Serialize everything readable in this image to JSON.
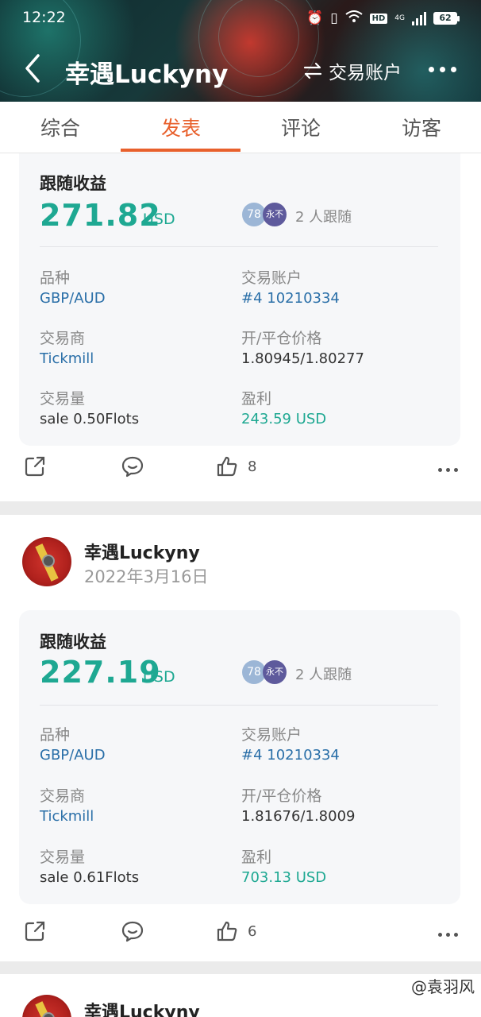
{
  "status_bar": {
    "time": "12:22",
    "network": "4G",
    "hd": "HD",
    "battery": "62"
  },
  "nav": {
    "title": "幸遇Luckyny",
    "switch_label": "交易账户"
  },
  "tabs": [
    {
      "label": "综合",
      "active": false
    },
    {
      "label": "发表",
      "active": true
    },
    {
      "label": "评论",
      "active": false
    },
    {
      "label": "访客",
      "active": false
    }
  ],
  "posts": [
    {
      "profit_title": "跟随收益",
      "amount": "271.82",
      "unit": "USD",
      "avatar1": "78",
      "avatar2": "永不",
      "followers": "2 人跟随",
      "fields": {
        "symbol_label": "品种",
        "symbol": "GBP/AUD",
        "account_label": "交易账户",
        "account": "#4 10210334",
        "broker_label": "交易商",
        "broker": "Tickmill",
        "price_label": "开/平仓价格",
        "price": "1.80945/1.80277",
        "volume_label": "交易量",
        "volume": "sale 0.50Flots",
        "pnl_label": "盈利",
        "pnl": "243.59 USD"
      },
      "likes": "8"
    },
    {
      "author": "幸遇Luckyny",
      "date": "2022年3月16日",
      "profit_title": "跟随收益",
      "amount": "227.19",
      "unit": "USD",
      "avatar1": "78",
      "avatar2": "永不",
      "followers": "2 人跟随",
      "fields": {
        "symbol_label": "品种",
        "symbol": "GBP/AUD",
        "account_label": "交易账户",
        "account": "#4 10210334",
        "broker_label": "交易商",
        "broker": "Tickmill",
        "price_label": "开/平仓价格",
        "price": "1.81676/1.8009",
        "volume_label": "交易量",
        "volume": "sale 0.61Flots",
        "pnl_label": "盈利",
        "pnl": "703.13 USD"
      },
      "likes": "6"
    },
    {
      "author": "幸遇Luckyny"
    }
  ],
  "watermark": "@袁羽风",
  "colors": {
    "accent": "#e8602c",
    "profit_green": "#1ea892",
    "link_blue": "#2a6fa8"
  }
}
